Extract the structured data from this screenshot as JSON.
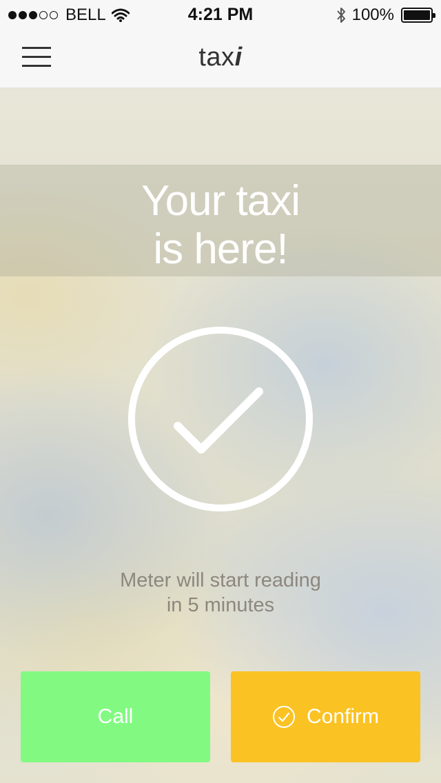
{
  "status_bar": {
    "signal_filled": 3,
    "signal_total": 5,
    "carrier": "BELL",
    "time": "4:21 PM",
    "battery": "100%",
    "icons": [
      "wifi-icon",
      "bluetooth-icon",
      "battery-icon"
    ]
  },
  "nav": {
    "brand_regular": "tax",
    "brand_bold": "i",
    "menu_icon": "hamburger-icon"
  },
  "banner": {
    "line1": "Your taxi",
    "line2": "is here!"
  },
  "status_icon": "check-circle-icon",
  "meter": {
    "line1": "Meter will start reading",
    "line2": "in 5 minutes"
  },
  "buttons": {
    "call": "Call",
    "confirm": "Confirm",
    "confirm_icon": "check-circle-small-icon"
  },
  "colors": {
    "call": "#82fa82",
    "confirm": "#fbc223"
  }
}
